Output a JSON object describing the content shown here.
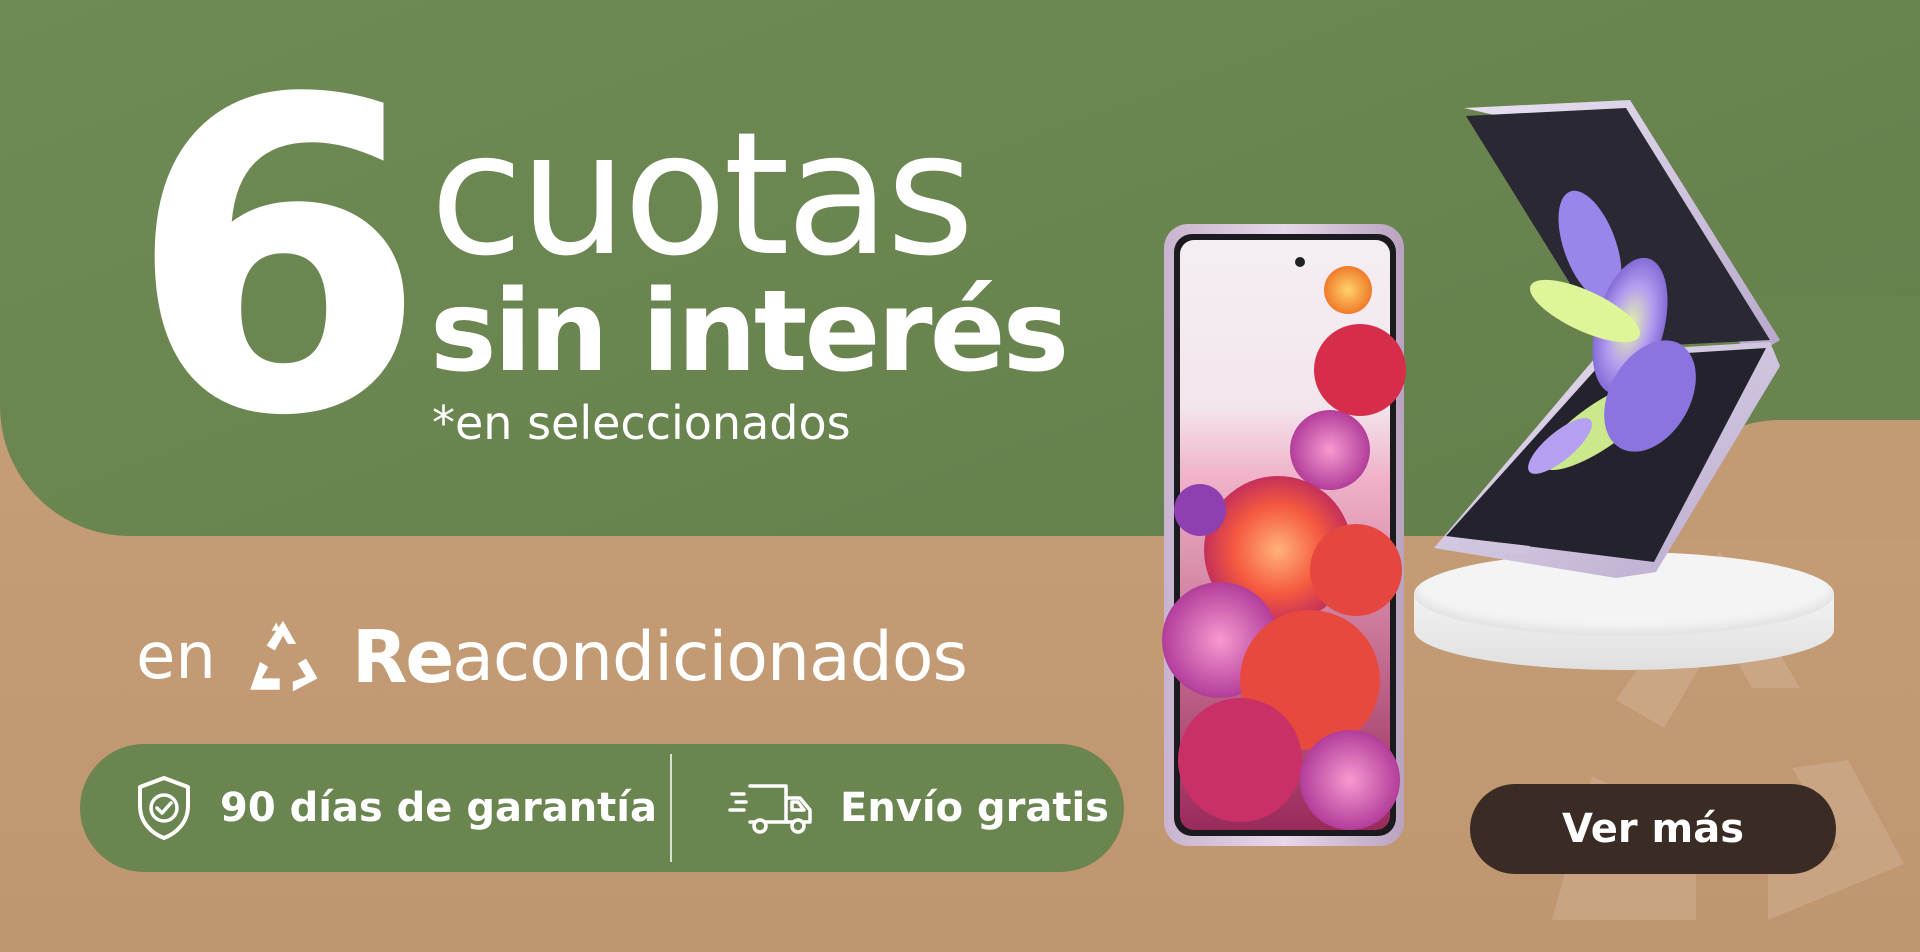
{
  "promo": {
    "number": "6",
    "line1": "cuotas",
    "line2": "sin interés",
    "note": "*en seleccionados"
  },
  "brand": {
    "prefix": "en",
    "name_bold": "Re",
    "name_rest": "acondicionados"
  },
  "benefits": [
    {
      "icon": "shield-check-icon",
      "label": "90 días de garantía"
    },
    {
      "icon": "delivery-truck-icon",
      "label": "Envío gratis"
    }
  ],
  "cta": {
    "label": "Ver más"
  },
  "colors": {
    "green": "#6b8550",
    "kraft": "#c29b74",
    "cta_bg": "#3a2b24",
    "text": "#ffffff"
  }
}
